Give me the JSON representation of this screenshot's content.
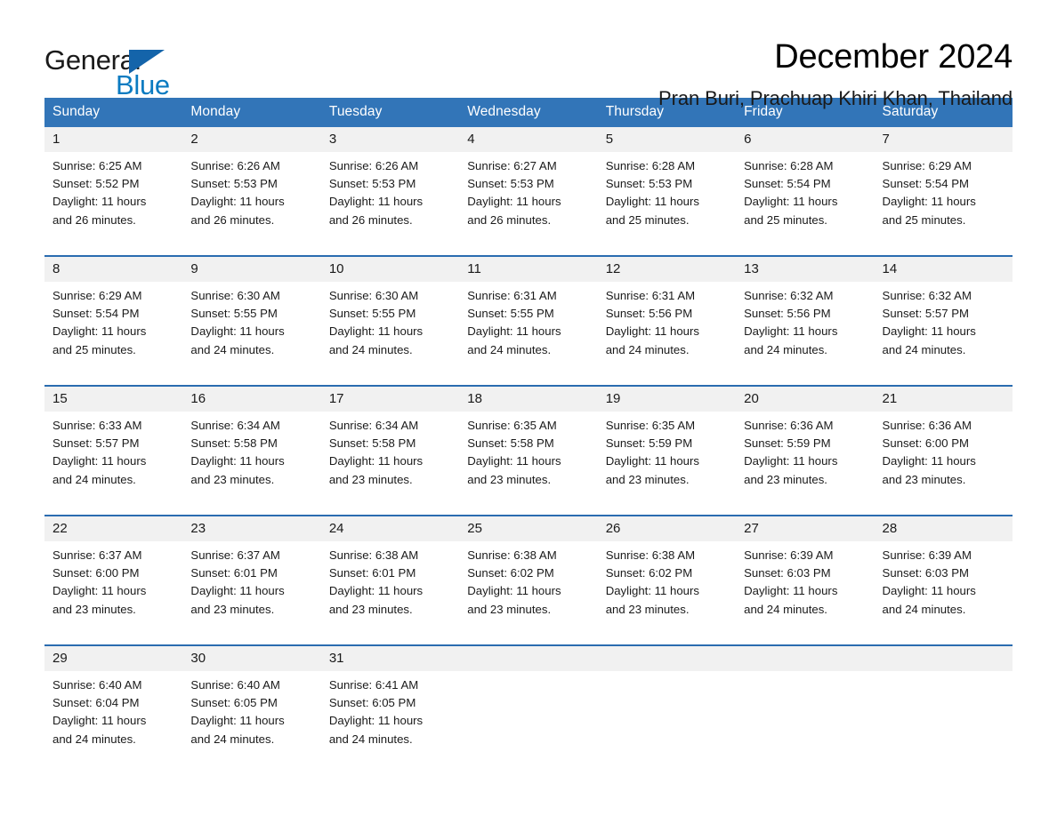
{
  "logo": {
    "word1": "General",
    "word2": "Blue",
    "triangle_color": "#1464aa",
    "blue_color": "#0b7bc1"
  },
  "header": {
    "title": "December 2024",
    "subtitle": "Pran Buri, Prachuap Khiri Khan, Thailand"
  },
  "theme": {
    "header_bg": "#3275b8",
    "header_text": "#ffffff",
    "daynum_bg": "#f1f1f1",
    "week_rule": "#2a6cb0"
  },
  "weekday_headers": [
    "Sunday",
    "Monday",
    "Tuesday",
    "Wednesday",
    "Thursday",
    "Friday",
    "Saturday"
  ],
  "weeks": [
    {
      "days": [
        {
          "num": "1",
          "sunrise": "Sunrise: 6:25 AM",
          "sunset": "Sunset: 5:52 PM",
          "daylight_1": "Daylight: 11 hours",
          "daylight_2": "and 26 minutes."
        },
        {
          "num": "2",
          "sunrise": "Sunrise: 6:26 AM",
          "sunset": "Sunset: 5:53 PM",
          "daylight_1": "Daylight: 11 hours",
          "daylight_2": "and 26 minutes."
        },
        {
          "num": "3",
          "sunrise": "Sunrise: 6:26 AM",
          "sunset": "Sunset: 5:53 PM",
          "daylight_1": "Daylight: 11 hours",
          "daylight_2": "and 26 minutes."
        },
        {
          "num": "4",
          "sunrise": "Sunrise: 6:27 AM",
          "sunset": "Sunset: 5:53 PM",
          "daylight_1": "Daylight: 11 hours",
          "daylight_2": "and 26 minutes."
        },
        {
          "num": "5",
          "sunrise": "Sunrise: 6:28 AM",
          "sunset": "Sunset: 5:53 PM",
          "daylight_1": "Daylight: 11 hours",
          "daylight_2": "and 25 minutes."
        },
        {
          "num": "6",
          "sunrise": "Sunrise: 6:28 AM",
          "sunset": "Sunset: 5:54 PM",
          "daylight_1": "Daylight: 11 hours",
          "daylight_2": "and 25 minutes."
        },
        {
          "num": "7",
          "sunrise": "Sunrise: 6:29 AM",
          "sunset": "Sunset: 5:54 PM",
          "daylight_1": "Daylight: 11 hours",
          "daylight_2": "and 25 minutes."
        }
      ]
    },
    {
      "days": [
        {
          "num": "8",
          "sunrise": "Sunrise: 6:29 AM",
          "sunset": "Sunset: 5:54 PM",
          "daylight_1": "Daylight: 11 hours",
          "daylight_2": "and 25 minutes."
        },
        {
          "num": "9",
          "sunrise": "Sunrise: 6:30 AM",
          "sunset": "Sunset: 5:55 PM",
          "daylight_1": "Daylight: 11 hours",
          "daylight_2": "and 24 minutes."
        },
        {
          "num": "10",
          "sunrise": "Sunrise: 6:30 AM",
          "sunset": "Sunset: 5:55 PM",
          "daylight_1": "Daylight: 11 hours",
          "daylight_2": "and 24 minutes."
        },
        {
          "num": "11",
          "sunrise": "Sunrise: 6:31 AM",
          "sunset": "Sunset: 5:55 PM",
          "daylight_1": "Daylight: 11 hours",
          "daylight_2": "and 24 minutes."
        },
        {
          "num": "12",
          "sunrise": "Sunrise: 6:31 AM",
          "sunset": "Sunset: 5:56 PM",
          "daylight_1": "Daylight: 11 hours",
          "daylight_2": "and 24 minutes."
        },
        {
          "num": "13",
          "sunrise": "Sunrise: 6:32 AM",
          "sunset": "Sunset: 5:56 PM",
          "daylight_1": "Daylight: 11 hours",
          "daylight_2": "and 24 minutes."
        },
        {
          "num": "14",
          "sunrise": "Sunrise: 6:32 AM",
          "sunset": "Sunset: 5:57 PM",
          "daylight_1": "Daylight: 11 hours",
          "daylight_2": "and 24 minutes."
        }
      ]
    },
    {
      "days": [
        {
          "num": "15",
          "sunrise": "Sunrise: 6:33 AM",
          "sunset": "Sunset: 5:57 PM",
          "daylight_1": "Daylight: 11 hours",
          "daylight_2": "and 24 minutes."
        },
        {
          "num": "16",
          "sunrise": "Sunrise: 6:34 AM",
          "sunset": "Sunset: 5:58 PM",
          "daylight_1": "Daylight: 11 hours",
          "daylight_2": "and 23 minutes."
        },
        {
          "num": "17",
          "sunrise": "Sunrise: 6:34 AM",
          "sunset": "Sunset: 5:58 PM",
          "daylight_1": "Daylight: 11 hours",
          "daylight_2": "and 23 minutes."
        },
        {
          "num": "18",
          "sunrise": "Sunrise: 6:35 AM",
          "sunset": "Sunset: 5:58 PM",
          "daylight_1": "Daylight: 11 hours",
          "daylight_2": "and 23 minutes."
        },
        {
          "num": "19",
          "sunrise": "Sunrise: 6:35 AM",
          "sunset": "Sunset: 5:59 PM",
          "daylight_1": "Daylight: 11 hours",
          "daylight_2": "and 23 minutes."
        },
        {
          "num": "20",
          "sunrise": "Sunrise: 6:36 AM",
          "sunset": "Sunset: 5:59 PM",
          "daylight_1": "Daylight: 11 hours",
          "daylight_2": "and 23 minutes."
        },
        {
          "num": "21",
          "sunrise": "Sunrise: 6:36 AM",
          "sunset": "Sunset: 6:00 PM",
          "daylight_1": "Daylight: 11 hours",
          "daylight_2": "and 23 minutes."
        }
      ]
    },
    {
      "days": [
        {
          "num": "22",
          "sunrise": "Sunrise: 6:37 AM",
          "sunset": "Sunset: 6:00 PM",
          "daylight_1": "Daylight: 11 hours",
          "daylight_2": "and 23 minutes."
        },
        {
          "num": "23",
          "sunrise": "Sunrise: 6:37 AM",
          "sunset": "Sunset: 6:01 PM",
          "daylight_1": "Daylight: 11 hours",
          "daylight_2": "and 23 minutes."
        },
        {
          "num": "24",
          "sunrise": "Sunrise: 6:38 AM",
          "sunset": "Sunset: 6:01 PM",
          "daylight_1": "Daylight: 11 hours",
          "daylight_2": "and 23 minutes."
        },
        {
          "num": "25",
          "sunrise": "Sunrise: 6:38 AM",
          "sunset": "Sunset: 6:02 PM",
          "daylight_1": "Daylight: 11 hours",
          "daylight_2": "and 23 minutes."
        },
        {
          "num": "26",
          "sunrise": "Sunrise: 6:38 AM",
          "sunset": "Sunset: 6:02 PM",
          "daylight_1": "Daylight: 11 hours",
          "daylight_2": "and 23 minutes."
        },
        {
          "num": "27",
          "sunrise": "Sunrise: 6:39 AM",
          "sunset": "Sunset: 6:03 PM",
          "daylight_1": "Daylight: 11 hours",
          "daylight_2": "and 24 minutes."
        },
        {
          "num": "28",
          "sunrise": "Sunrise: 6:39 AM",
          "sunset": "Sunset: 6:03 PM",
          "daylight_1": "Daylight: 11 hours",
          "daylight_2": "and 24 minutes."
        }
      ]
    },
    {
      "days": [
        {
          "num": "29",
          "sunrise": "Sunrise: 6:40 AM",
          "sunset": "Sunset: 6:04 PM",
          "daylight_1": "Daylight: 11 hours",
          "daylight_2": "and 24 minutes."
        },
        {
          "num": "30",
          "sunrise": "Sunrise: 6:40 AM",
          "sunset": "Sunset: 6:05 PM",
          "daylight_1": "Daylight: 11 hours",
          "daylight_2": "and 24 minutes."
        },
        {
          "num": "31",
          "sunrise": "Sunrise: 6:41 AM",
          "sunset": "Sunset: 6:05 PM",
          "daylight_1": "Daylight: 11 hours",
          "daylight_2": "and 24 minutes."
        },
        {
          "num": "",
          "sunrise": "",
          "sunset": "",
          "daylight_1": "",
          "daylight_2": ""
        },
        {
          "num": "",
          "sunrise": "",
          "sunset": "",
          "daylight_1": "",
          "daylight_2": ""
        },
        {
          "num": "",
          "sunrise": "",
          "sunset": "",
          "daylight_1": "",
          "daylight_2": ""
        },
        {
          "num": "",
          "sunrise": "",
          "sunset": "",
          "daylight_1": "",
          "daylight_2": ""
        }
      ]
    }
  ]
}
